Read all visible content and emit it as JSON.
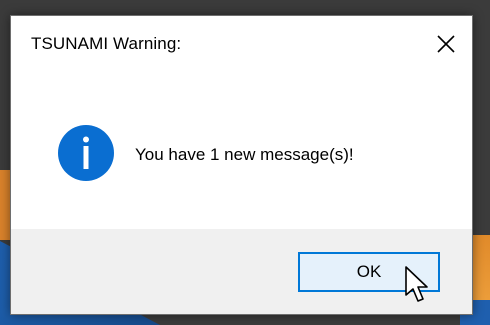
{
  "dialog": {
    "title": "TSUNAMI Warning:",
    "message": "You have 1 new message(s)!",
    "ok_label": "OK"
  },
  "icons": {
    "close": "close-icon",
    "info": "info-icon",
    "cursor": "mouse-pointer-icon"
  },
  "colors": {
    "accent": "#0078d7",
    "info_icon": "#0a6ed1",
    "footer_bg": "#f0f0f0",
    "button_bg": "#e5f1fb"
  }
}
